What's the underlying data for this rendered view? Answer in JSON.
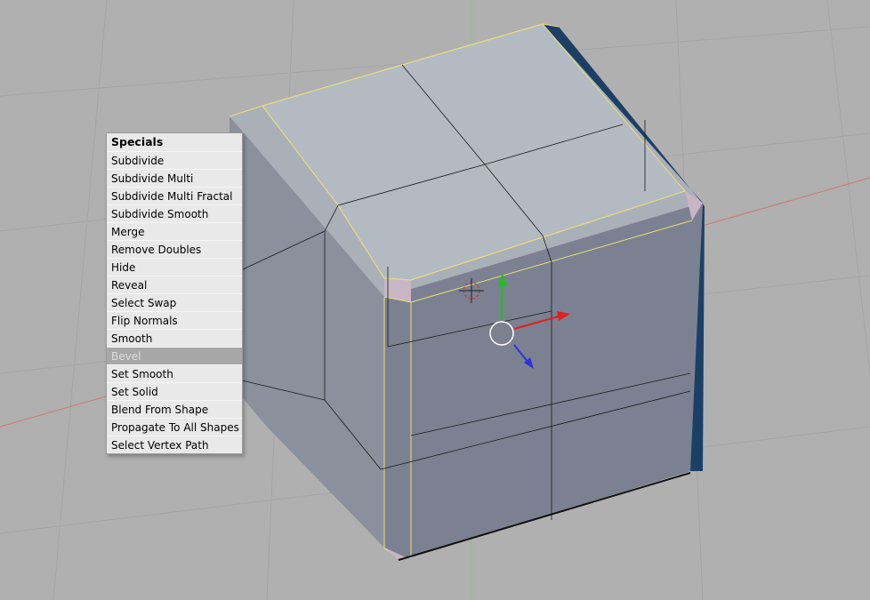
{
  "specials_menu": {
    "title": "Specials",
    "highlighted_item": "Bevel",
    "items": [
      "Subdivide",
      "Subdivide Multi",
      "Subdivide Multi Fractal",
      "Subdivide Smooth",
      "Merge",
      "Remove Doubles",
      "Hide",
      "Reveal",
      "Select Swap",
      "Flip Normals",
      "Smooth",
      "Bevel",
      "Set Smooth",
      "Set Solid",
      "Blend From Shape",
      "Propagate To All Shapes",
      "Select Vertex Path"
    ]
  },
  "viewport": {
    "background_color": "#b0b0b0",
    "object": "beveled-cube-mesh",
    "selected_edge_color": "#e6e07a",
    "axis_colors": {
      "x": "#e02020",
      "y": "#20c020",
      "z": "#3030e0"
    }
  }
}
